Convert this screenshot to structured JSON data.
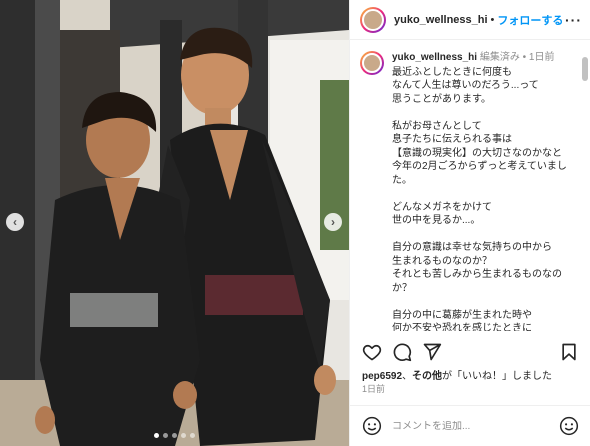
{
  "post": {
    "username": "yuko_wellness_hi",
    "header_separator": "•",
    "follow_label": "フォローする",
    "more_label": "···",
    "photo_alt": "",
    "carousel": {
      "slide_count": 5,
      "active_index": 0
    }
  },
  "caption": {
    "username": "yuko_wellness_hi",
    "edited_label": "編集済み",
    "meta_separator": "•",
    "time": "1日前",
    "text": "最近ふとしたときに何度も\nなんて人生は尊いのだろう...って\n思うことがあります。\n\n私がお母さんとして\n息子たちに伝えられる事は\n【意識の現実化】の大切さなのかなと\n今年の2月ごろからずっと考えていました。\n\nどんなメガネをかけて\n世の中を見るか...。\n\n自分の意識は幸せな気持ちの中から\n生まれるものなのか？\nそれとも苦しみから生まれるものなのか？\n\n自分の中に葛藤が生まれた時や\n何か不安や恐れを感じたときに\nいつも原点戻って確かめに"
  },
  "actions": {
    "like_icon": "heart-icon",
    "comment_icon": "comment-icon",
    "share_icon": "send-icon",
    "save_icon": "bookmark-icon"
  },
  "likes": {
    "user": "pep6592",
    "separator": "、",
    "others": "その他",
    "suffix": "が「いいね！」しました"
  },
  "date": "1日前",
  "comment": {
    "emoji_icon": "emoji-icon",
    "placeholder": "コメントを追加...",
    "smile_icon": "smile-icon"
  },
  "colors": {
    "follow_blue": "#0095f6",
    "muted_text": "#8e8e8e",
    "border": "#efefef"
  }
}
